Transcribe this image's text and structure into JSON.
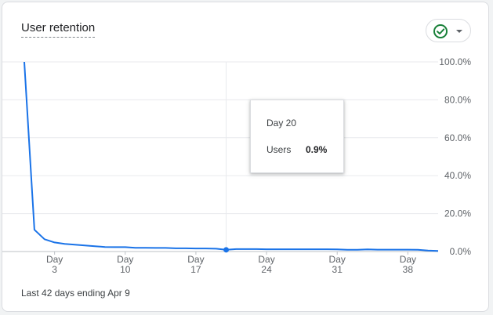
{
  "card": {
    "title": "User retention",
    "footer": "Last 42 days ending Apr 9",
    "compare_button": {
      "icon": "check-circle-icon",
      "caret": "caret-down-icon"
    }
  },
  "tooltip": {
    "title": "Day 20",
    "label": "Users",
    "value": "0.9%"
  },
  "colors": {
    "line": "#1a73e8",
    "grid": "#e8eaed",
    "check": "#188038"
  },
  "chart_data": {
    "type": "line",
    "title": "User retention",
    "xlabel": "",
    "ylabel": "",
    "x": [
      0,
      1,
      2,
      3,
      4,
      5,
      6,
      7,
      8,
      9,
      10,
      11,
      12,
      13,
      14,
      15,
      16,
      17,
      18,
      19,
      20,
      21,
      22,
      23,
      24,
      25,
      26,
      27,
      28,
      29,
      30,
      31,
      32,
      33,
      34,
      35,
      36,
      37,
      38,
      39,
      40,
      41
    ],
    "series": [
      {
        "values": [
          100,
          11.5,
          6.5,
          4.8,
          4.0,
          3.6,
          3.2,
          2.8,
          2.4,
          2.3,
          2.3,
          2.0,
          2.0,
          1.9,
          1.9,
          1.7,
          1.7,
          1.6,
          1.6,
          1.5,
          0.9,
          1.3,
          1.3,
          1.3,
          1.2,
          1.2,
          1.2,
          1.2,
          1.2,
          1.2,
          1.2,
          1.1,
          0.9,
          0.9,
          1.1,
          1.0,
          1.0,
          1.0,
          1.0,
          0.9,
          0.5,
          0.3
        ]
      }
    ],
    "ylim": [
      0,
      100
    ],
    "y_ticks": [
      "100.0%",
      "80.0%",
      "60.0%",
      "40.0%",
      "20.0%",
      "0.0%"
    ],
    "y_tick_values": [
      100,
      80,
      60,
      40,
      20,
      0
    ],
    "x_ticks": [
      {
        "day": 3,
        "line1": "Day",
        "line2": "3"
      },
      {
        "day": 10,
        "line1": "Day",
        "line2": "10"
      },
      {
        "day": 17,
        "line1": "Day",
        "line2": "17"
      },
      {
        "day": 24,
        "line1": "Day",
        "line2": "24"
      },
      {
        "day": 31,
        "line1": "Day",
        "line2": "31"
      },
      {
        "day": 38,
        "line1": "Day",
        "line2": "38"
      }
    ],
    "highlight_index": 20,
    "grid": true,
    "legend": "none"
  }
}
